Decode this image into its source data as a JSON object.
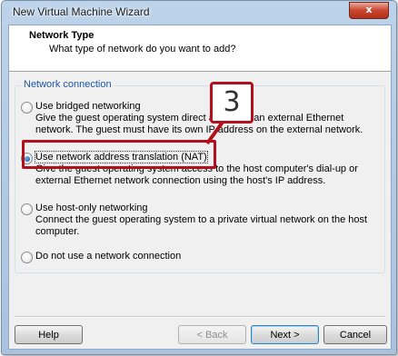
{
  "window": {
    "title": "New Virtual Machine Wizard",
    "close_glyph": "x"
  },
  "header": {
    "title": "Network Type",
    "subtitle": "What type of network do you want to add?"
  },
  "group": {
    "label": "Network connection"
  },
  "options": [
    {
      "label": "Use bridged networking",
      "description": "Give the guest operating system direct access to an external Ethernet network. The guest must have its own IP address on the external network.",
      "selected": false
    },
    {
      "label": "Use network address translation (NAT)",
      "description": "Give the guest operating system access to the host computer's dial-up or external Ethernet network connection using the host's IP address.",
      "selected": true
    },
    {
      "label": "Use host-only networking",
      "description": "Connect the guest operating system to a private virtual network on the host computer.",
      "selected": false
    },
    {
      "label": "Do not use a network connection",
      "description": "",
      "selected": false
    }
  ],
  "annotation": {
    "step_number": "3",
    "color": "#b40f1c"
  },
  "buttons": {
    "help": "Help",
    "back": "< Back",
    "next": "Next >",
    "cancel": "Cancel"
  },
  "icons": {
    "close": "close-icon",
    "radio": "radio-button"
  }
}
